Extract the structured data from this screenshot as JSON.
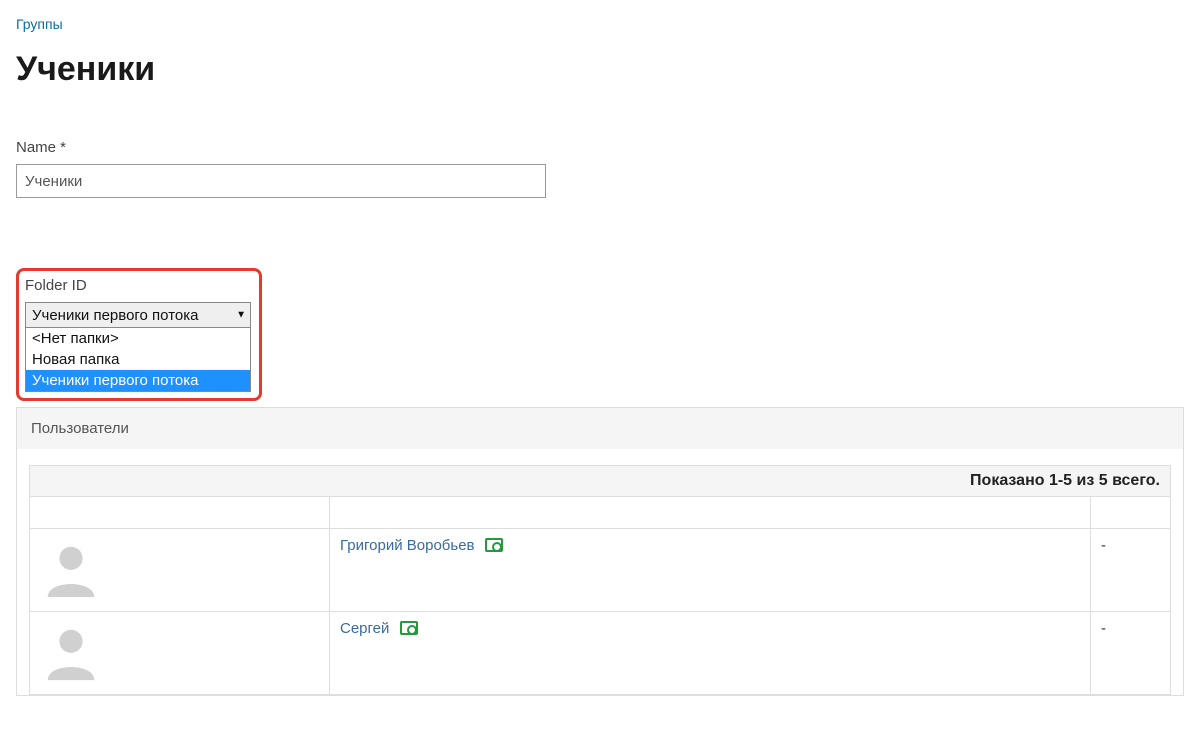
{
  "breadcrumb": {
    "label": "Группы"
  },
  "page": {
    "title": "Ученики"
  },
  "name_field": {
    "label": "Name *",
    "value": "Ученики"
  },
  "folder": {
    "label": "Folder ID",
    "selected": "Ученики первого потока",
    "options": [
      {
        "label": "<Нет папки>",
        "selected": false
      },
      {
        "label": "Новая папка",
        "selected": false
      },
      {
        "label": "Ученики первого потока",
        "selected": true
      }
    ]
  },
  "users_panel": {
    "header": "Пользователи",
    "summary": "Показано 1-5 из 5 всего.",
    "columns": {
      "avatar": "",
      "name": "",
      "action": ""
    },
    "rows": [
      {
        "name": "Григорий Воробьев",
        "action": "-"
      },
      {
        "name": "Сергей",
        "action": "-"
      }
    ]
  }
}
